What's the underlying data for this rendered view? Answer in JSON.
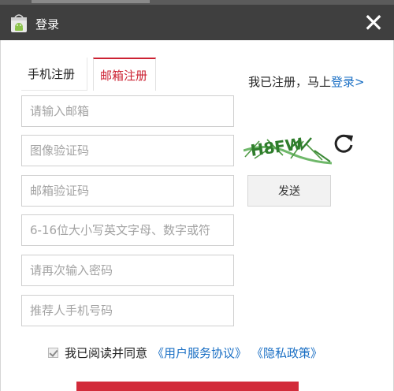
{
  "window": {
    "title": "登录",
    "close_glyph": "✕",
    "icon": "android-shopping-bag-icon"
  },
  "tabs": [
    {
      "label": "手机注册",
      "active": false
    },
    {
      "label": "邮箱注册",
      "active": true
    }
  ],
  "login_hint": {
    "text": "我已注册，马上",
    "link": "登录>"
  },
  "form": {
    "email_placeholder": "请输入邮箱",
    "image_code_placeholder": "图像验证码",
    "email_code_placeholder": "邮箱验证码",
    "password_placeholder": "6-16位大小写英文字母、数字或符",
    "confirm_password_placeholder": "请再次输入密码",
    "referrer_placeholder": "推荐人手机号码"
  },
  "captcha": {
    "text": "H8FW"
  },
  "send_button": "发送",
  "agreement": {
    "checked": true,
    "text": "我已阅读并同意",
    "user_agreement": "《用户服务协议》",
    "privacy_policy": "《隐私政策》"
  },
  "colors": {
    "accent": "#cc2233",
    "link": "#1a6fc4",
    "titlebar": "#3f3f3f",
    "submit": "#d22b3a"
  }
}
